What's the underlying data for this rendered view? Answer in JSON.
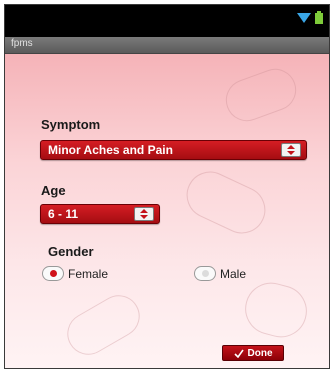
{
  "app": {
    "title": "fpms"
  },
  "symptom": {
    "label": "Symptom",
    "selected": "Minor Aches and Pain"
  },
  "age": {
    "label": "Age",
    "selected": "6 - 11"
  },
  "gender": {
    "label": "Gender",
    "options": [
      {
        "label": "Female",
        "checked": true
      },
      {
        "label": "Male",
        "checked": false
      }
    ]
  },
  "done_button": {
    "label": "Done",
    "icon": "hand-check-icon"
  },
  "status": {
    "icons": [
      "wifi-icon",
      "battery-icon"
    ]
  },
  "colors": {
    "accent": "#c4121a",
    "background": "#fbd4d7",
    "statusbar": "#000000"
  }
}
